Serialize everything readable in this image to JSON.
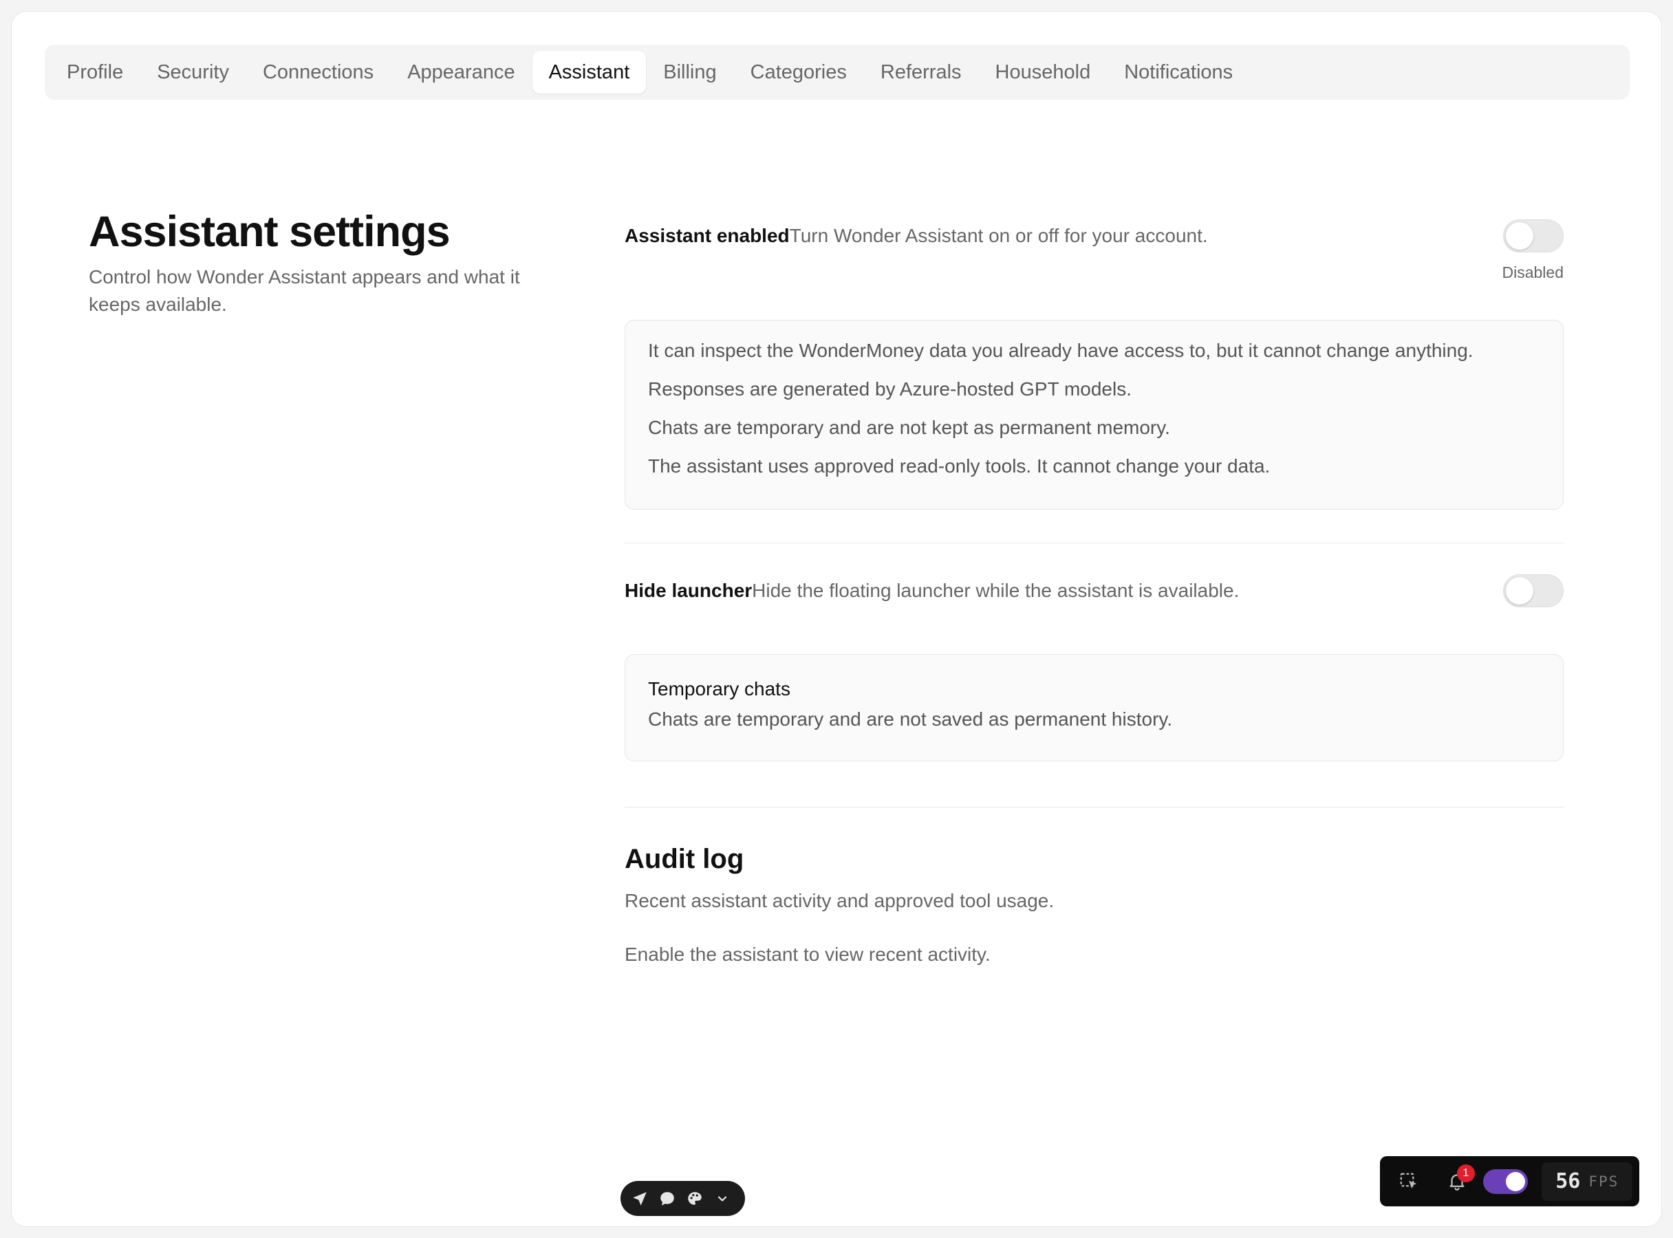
{
  "tabs": [
    {
      "label": "Profile",
      "active": false
    },
    {
      "label": "Security",
      "active": false
    },
    {
      "label": "Connections",
      "active": false
    },
    {
      "label": "Appearance",
      "active": false
    },
    {
      "label": "Assistant",
      "active": true
    },
    {
      "label": "Billing",
      "active": false
    },
    {
      "label": "Categories",
      "active": false
    },
    {
      "label": "Referrals",
      "active": false
    },
    {
      "label": "Household",
      "active": false
    },
    {
      "label": "Notifications",
      "active": false
    }
  ],
  "page": {
    "title": "Assistant settings",
    "subtitle": "Control how Wonder Assistant appears and what it keeps available."
  },
  "assistant_enabled": {
    "label": "Assistant enabled",
    "description": "Turn Wonder Assistant on or off for your account.",
    "status": "Disabled",
    "on": false
  },
  "info": {
    "lines": [
      "It can inspect the WonderMoney data you already have access to, but it cannot change anything.",
      "Responses are generated by Azure-hosted GPT models.",
      "Chats are temporary and are not kept as permanent memory.",
      "The assistant uses approved read-only tools. It cannot change your data."
    ]
  },
  "hide_launcher": {
    "label": "Hide launcher",
    "description": "Hide the floating launcher while the assistant is available.",
    "on": false
  },
  "temporary_chats": {
    "title": "Temporary chats",
    "description": "Chats are temporary and are not saved as permanent history."
  },
  "audit_log": {
    "title": "Audit log",
    "description": "Recent assistant activity and approved tool usage.",
    "empty": "Enable the assistant to view recent activity."
  },
  "mini_toolbar": {
    "icons": [
      "send-icon",
      "chat-bubble-icon",
      "palette-icon",
      "chevron-down-icon"
    ]
  },
  "dev_bar": {
    "notification_count": "1",
    "fps_value": "56",
    "fps_label": "FPS",
    "toggle_on": true,
    "accent": "#6b3fb8",
    "badge_color": "#e11d2e"
  }
}
